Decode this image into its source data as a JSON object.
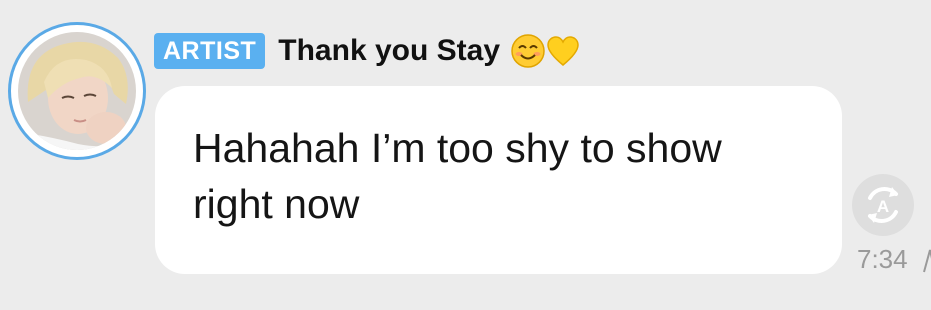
{
  "message": {
    "badge_label": "ARTIST",
    "sender_title": "Thank you Stay",
    "title_emojis": [
      "smiling-face-with-smiling-eyes-emoji",
      "yellow-heart-emoji"
    ],
    "body_text": "Hahahah I’m too shy to show\nright now",
    "time": "7:34",
    "translate_icon": "translate-icon",
    "avatar_icon": "avatar-photo"
  },
  "colors": {
    "background": "#ececec",
    "bubble": "#ffffff",
    "badge": "#5ab0f0",
    "avatar_ring": "#5aa9e6",
    "timestamp": "#9a9a9a"
  }
}
